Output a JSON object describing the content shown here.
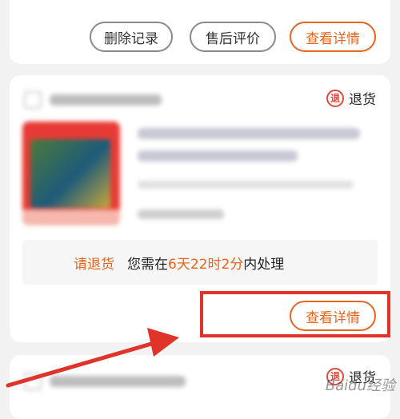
{
  "card1": {
    "buttons": {
      "delete": "删除记录",
      "review": "售后评价",
      "details": "查看详情"
    }
  },
  "card2": {
    "return_label": "退货",
    "return_icon_glyph": "退",
    "notice": {
      "label": "请退货",
      "prefix": "您需在",
      "deadline": "6天22时2分",
      "suffix": "内处理"
    },
    "details_button": "查看详情"
  },
  "card3": {
    "return_label": "退货",
    "return_icon_glyph": "退"
  },
  "watermark": "Baidu经验",
  "colors": {
    "accent": "#e8651d",
    "highlight_box": "#e0332a",
    "return_icon": "#e24a3b"
  }
}
